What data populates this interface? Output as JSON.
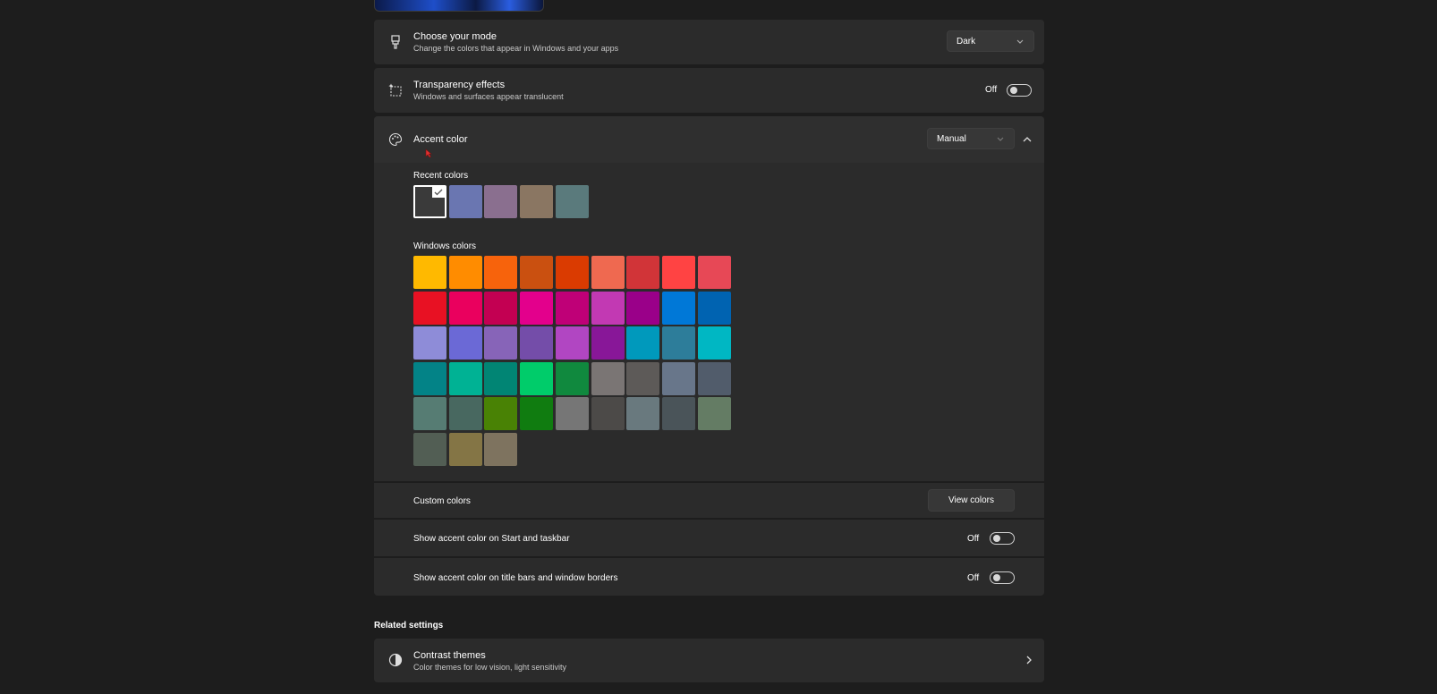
{
  "mode": {
    "title": "Choose your mode",
    "subtitle": "Change the colors that appear in Windows and your apps",
    "value": "Dark",
    "icon": "paintbrush-icon"
  },
  "transparency": {
    "title": "Transparency effects",
    "subtitle": "Windows and surfaces appear translucent",
    "state": "Off",
    "icon": "transparency-icon"
  },
  "accent": {
    "title": "Accent color",
    "value": "Manual",
    "icon": "palette-icon",
    "recent_label": "Recent colors",
    "recent_colors": [
      "#3a3a3a",
      "#6a76b1",
      "#8a6f8f",
      "#8a7662",
      "#5a7a7c"
    ],
    "recent_selected_index": 0,
    "windows_label": "Windows colors",
    "windows_colors": [
      [
        "#ffb900",
        "#ff8c00",
        "#f7630c",
        "#ca5010",
        "#da3b01",
        "#ef6950",
        "#d13438",
        "#ff4343",
        "#e74856"
      ],
      [
        "#e81123",
        "#ea005e",
        "#c30052",
        "#e3008c",
        "#bf0077",
        "#c239b3",
        "#9a0089",
        "#0078d7",
        "#0063b1"
      ],
      [
        "#8e8cd8",
        "#6b69d6",
        "#8764b8",
        "#744da9",
        "#b146c2",
        "#881798",
        "#0099bc",
        "#2d7d9a",
        "#00b7c3"
      ],
      [
        "#038387",
        "#00b294",
        "#018574",
        "#00cc6a",
        "#10893e",
        "#7a7574",
        "#5d5a58",
        "#68768a",
        "#515c6b"
      ],
      [
        "#567c73",
        "#486860",
        "#498205",
        "#107c10",
        "#767676",
        "#4c4a48",
        "#69797e",
        "#4a5459",
        "#647c64"
      ],
      [
        "#525e54",
        "#847545",
        "#7e735f"
      ]
    ],
    "custom_label": "Custom colors",
    "view_colors_label": "View colors",
    "start_taskbar_label": "Show accent color on Start and taskbar",
    "start_taskbar_state": "Off",
    "title_bars_label": "Show accent color on title bars and window borders",
    "title_bars_state": "Off"
  },
  "related": {
    "heading": "Related settings",
    "contrast_title": "Contrast themes",
    "contrast_subtitle": "Color themes for low vision, light sensitivity",
    "icon": "contrast-icon"
  }
}
